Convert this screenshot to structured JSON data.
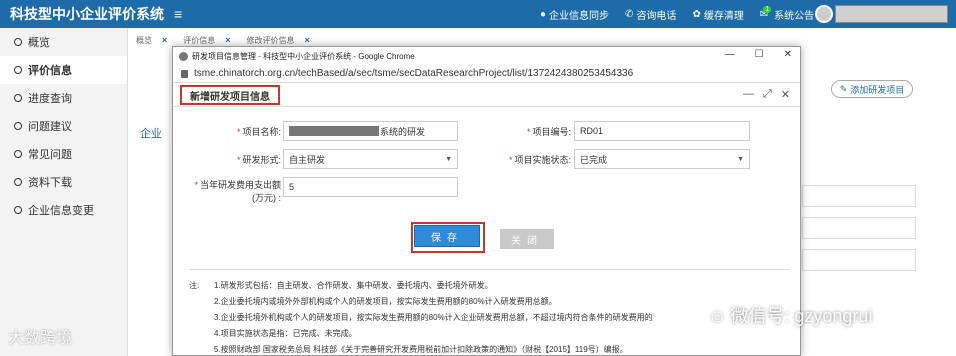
{
  "app": {
    "title": "科技型中小企业评价系统"
  },
  "top_menu": {
    "sync": "企业信息同步",
    "hotline": "咨询电话",
    "clear_cache": "缓存清理",
    "notice": "系统公告",
    "notice_badge": "1"
  },
  "sidebar": {
    "items": [
      {
        "label": "概览"
      },
      {
        "label": "评价信息"
      },
      {
        "label": "进度查询"
      },
      {
        "label": "问题建议"
      },
      {
        "label": "常见问题"
      },
      {
        "label": "资料下载"
      },
      {
        "label": "企业信息变更"
      }
    ]
  },
  "tabs": [
    {
      "label": "概览"
    },
    {
      "label": "评价信息"
    },
    {
      "label": "修改评价信息"
    }
  ],
  "background": {
    "add_project_button": "添加研发项目",
    "section_label": "企业"
  },
  "browser": {
    "title": "研发项目信息管理 - 科技型中小企业评价系统 - Google Chrome",
    "url": "tsme.chinatorch.org.cn/techBased/a/sec/tsme/secDataResearchProject/list/1372424380253454336"
  },
  "dialog": {
    "title": "新增研发项目信息",
    "fields": {
      "project_name_label": "项目名称:",
      "project_name_suffix": "系统的研发",
      "project_no_label": "项目编号:",
      "project_no_value": "RD01",
      "form_label": "研发形式:",
      "form_value": "自主研发",
      "status_label": "项目实施状态:",
      "status_value": "已完成",
      "expense_label_1": "当年研发费用支出额",
      "expense_label_2": "(万元) :",
      "expense_value": "5"
    },
    "save_label": "保存",
    "close_label": "关闭",
    "notes_prefix": "注:",
    "notes": [
      "1.研发形式包括：自主研发、合作研发、集中研发、委托境内、委托境外研发。",
      "2.企业委托境内或境外外部机构或个人的研发项目，按实际发生费用额的80%计入研发费用总额。",
      "3.企业委托境外机构或个人的研发项目，按实际发生费用额的80%计入企业研发费用总额，不超过境内符合条件的研发费用的",
      "4.项目实施状态是指：已完成、未完成。",
      "5.按照财政部 国家税务总局 科技部《关于完善研究开发费用税前加计扣除政策的通知》（财税【2015】119号）编报。"
    ]
  },
  "watermarks": {
    "left": "大数跨境",
    "right": "微信号: gzyongrui"
  },
  "colors": {
    "topbar": "#1d6ba8",
    "highlight_red": "#c0392b",
    "save_blue": "#2e8bd8"
  }
}
